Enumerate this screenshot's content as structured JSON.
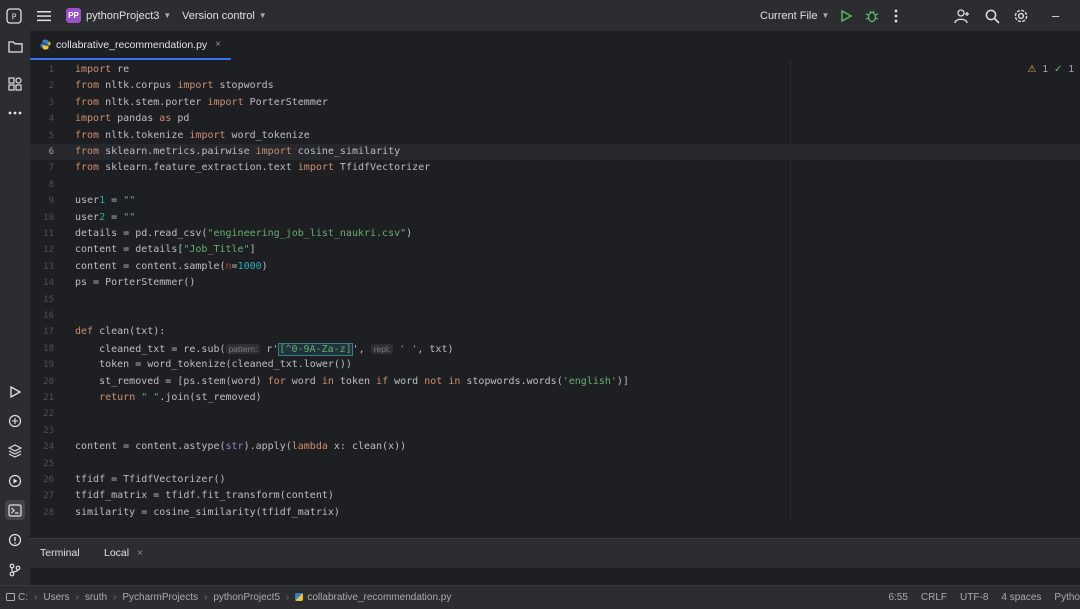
{
  "titlebar": {
    "project_badge": "PP",
    "project_name": "pythonProject3",
    "vcs_label": "Version control",
    "run_config": "Current File",
    "minimize": "–"
  },
  "tab": {
    "filename": "collabrative_recommendation.py",
    "close": "×"
  },
  "inspections": {
    "warnings": "1",
    "ok": "1"
  },
  "editor": {
    "current_line": 6,
    "lines": [
      {
        "n": "1",
        "code": "import re"
      },
      {
        "n": "2",
        "code": "from nltk.corpus import stopwords"
      },
      {
        "n": "3",
        "code": "from nltk.stem.porter import PorterStemmer"
      },
      {
        "n": "4",
        "code": "import pandas as pd"
      },
      {
        "n": "5",
        "code": "from nltk.tokenize import word_tokenize"
      },
      {
        "n": "6",
        "code": "from sklearn.metrics.pairwise import cosine_similarity"
      },
      {
        "n": "7",
        "code": "from sklearn.feature_extraction.text import TfidfVectorizer"
      },
      {
        "n": "8",
        "code": ""
      },
      {
        "n": "9",
        "code": "user1 = \"\""
      },
      {
        "n": "10",
        "code": "user2 = \"\""
      },
      {
        "n": "11",
        "code": "details = pd.read_csv(\"engineering_job_list_naukri.csv\")"
      },
      {
        "n": "12",
        "code": "content = details[\"Job_Title\"]"
      },
      {
        "n": "13",
        "code": "content = content.sample(n=1000)"
      },
      {
        "n": "14",
        "code": "ps = PorterStemmer()"
      },
      {
        "n": "15",
        "code": ""
      },
      {
        "n": "16",
        "code": ""
      },
      {
        "n": "17",
        "code": "def clean(txt):"
      },
      {
        "n": "18",
        "code": "    cleaned_txt = re.sub(pattern: r'[^0-9A-Za-z]', repl: ' ', txt)"
      },
      {
        "n": "19",
        "code": "    token = word_tokenize(cleaned_txt.lower())"
      },
      {
        "n": "20",
        "code": "    st_removed = [ps.stem(word) for word in token if word not in stopwords.words('english')]"
      },
      {
        "n": "21",
        "code": "    return \" \".join(st_removed)"
      },
      {
        "n": "22",
        "code": ""
      },
      {
        "n": "23",
        "code": ""
      },
      {
        "n": "24",
        "code": "content = content.astype(str).apply(lambda x: clean(x))"
      },
      {
        "n": "25",
        "code": ""
      },
      {
        "n": "26",
        "code": "tfidf = TfidfVectorizer()"
      },
      {
        "n": "27",
        "code": "tfidf_matrix = tfidf.fit_transform(content)"
      },
      {
        "n": "28",
        "code": "similarity = cosine_similarity(tfidf_matrix)"
      }
    ]
  },
  "terminal": {
    "title": "Terminal",
    "tab_label": "Local",
    "tab_close": "×"
  },
  "breadcrumbs": [
    "C:",
    "Users",
    "sruth",
    "PycharmProjects",
    "pythonProject5",
    "collabrative_recommendation.py"
  ],
  "status": {
    "position": "6:55",
    "line_sep": "CRLF",
    "encoding": "UTF-8",
    "indent": "4 spaces",
    "interpreter": "Pytho"
  }
}
